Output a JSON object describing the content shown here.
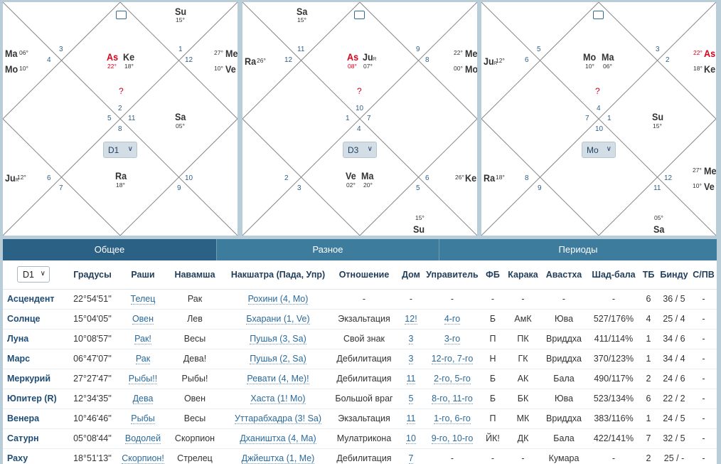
{
  "charts": [
    {
      "selector": "D1",
      "houses": [
        "1",
        "2",
        "3",
        "4",
        "5",
        "6",
        "7",
        "8",
        "9",
        "10",
        "11",
        "12"
      ],
      "planets": [
        {
          "name": "Su",
          "deg": "15°"
        },
        {
          "name": "As",
          "deg": "22°"
        },
        {
          "name": "Ke",
          "deg": "18°"
        },
        {
          "name": "Ma",
          "deg": "06°"
        },
        {
          "name": "Mo",
          "deg": "10°"
        },
        {
          "name": "Me",
          "deg": "27°"
        },
        {
          "name": "Ve",
          "deg": "10°"
        },
        {
          "name": "Sa",
          "deg": "05°"
        },
        {
          "name": "Ju",
          "deg": "12°",
          "sub": "R"
        },
        {
          "name": "Ra",
          "deg": "18°"
        }
      ]
    },
    {
      "selector": "D3",
      "houses": [
        "11",
        "12",
        "9",
        "8",
        "10",
        "1",
        "7",
        "4",
        "2",
        "3",
        "5",
        "6"
      ],
      "planets": [
        {
          "name": "Sa",
          "deg": "15°"
        },
        {
          "name": "Ra",
          "deg": "26°"
        },
        {
          "name": "As",
          "deg": "08°"
        },
        {
          "name": "Ju",
          "deg": "07°",
          "sub": "R"
        },
        {
          "name": "Me",
          "deg": "22°"
        },
        {
          "name": "Mo",
          "deg": "00°"
        },
        {
          "name": "Ve",
          "deg": "02°"
        },
        {
          "name": "Ma",
          "deg": "20°"
        },
        {
          "name": "Ke",
          "deg": "26°"
        },
        {
          "name": "Su",
          "deg": "15°"
        }
      ]
    },
    {
      "selector": "Mo",
      "houses": [
        "5",
        "6",
        "3",
        "2",
        "4",
        "7",
        "1",
        "10",
        "8",
        "9",
        "11",
        "12"
      ],
      "planets": [
        {
          "name": "Ju",
          "deg": "12°",
          "sub": "R"
        },
        {
          "name": "Mo",
          "deg": "10°"
        },
        {
          "name": "Ma",
          "deg": "06°"
        },
        {
          "name": "As",
          "deg": "22°"
        },
        {
          "name": "Ke",
          "deg": "18°"
        },
        {
          "name": "Su",
          "deg": "15°"
        },
        {
          "name": "Ra",
          "deg": "18°"
        },
        {
          "name": "Me",
          "deg": "27°"
        },
        {
          "name": "Ve",
          "deg": "10°"
        },
        {
          "name": "Sa",
          "deg": "05°"
        }
      ]
    }
  ],
  "question_mark": "?",
  "tabs": [
    "Общее",
    "Разное",
    "Периоды"
  ],
  "table": {
    "selector": "D1",
    "headers": [
      "Градусы",
      "Раши",
      "Навамша",
      "Накшатра (Пада, Упр)",
      "Отношение",
      "Дом",
      "Управитель",
      "ФБ",
      "Карака",
      "Авастха",
      "Шад-бала",
      "ТБ",
      "Бинду",
      "С/ПВ"
    ],
    "rows": [
      [
        "Асцендент",
        "22°54'51''",
        "Телец",
        "Рак",
        "Рохини (4, Mo)",
        "-",
        "-",
        "-",
        "-",
        "-",
        "-",
        "-",
        "6",
        "36 / 5",
        "-"
      ],
      [
        "Солнце",
        "15°04'05''",
        "Овен",
        "Лев",
        "Бхарани (1, Ve)",
        "Экзальтация",
        "12!",
        "4-го",
        "Б",
        "АмК",
        "Юва",
        "527/176%",
        "4",
        "25 / 4",
        "-"
      ],
      [
        "Луна",
        "10°08'57''",
        "Рак!",
        "Весы",
        "Пушья (3, Sa)",
        "Свой знак",
        "3",
        "3-го",
        "П",
        "ПК",
        "Вриддха",
        "411/114%",
        "1",
        "34 / 6",
        "-"
      ],
      [
        "Марс",
        "06°47'07''",
        "Рак",
        "Дева!",
        "Пушья (2, Sa)",
        "Дебилитация",
        "3",
        "12-го, 7-го",
        "Н",
        "ГК",
        "Вриддха",
        "370/123%",
        "1",
        "34 / 4",
        "-"
      ],
      [
        "Меркурий",
        "27°27'47''",
        "Рыбы!!",
        "Рыбы!",
        "Ревати (4, Me)!",
        "Дебилитация",
        "11",
        "2-го, 5-го",
        "Б",
        "АК",
        "Бала",
        "490/117%",
        "2",
        "24 / 6",
        "-"
      ],
      [
        "Юпитер (R)",
        "12°34'35''",
        "Дева",
        "Овен",
        "Хаста (1! Mo)",
        "Большой враг",
        "5",
        "8-го, 11-го",
        "Б",
        "БК",
        "Юва",
        "523/134%",
        "6",
        "22 / 2",
        "-"
      ],
      [
        "Венера",
        "10°46'46''",
        "Рыбы",
        "Весы",
        "Уттарабхадра (3! Sa)",
        "Экзальтация",
        "11",
        "1-го, 6-го",
        "П",
        "МК",
        "Вриддха",
        "383/116%",
        "1",
        "24 / 5",
        "-"
      ],
      [
        "Сатурн",
        "05°08'44''",
        "Водолей",
        "Скорпион",
        "Дхаништха (4, Ma)",
        "Мулатрикона",
        "10",
        "9-го, 10-го",
        "ЙК!",
        "ДК",
        "Бала",
        "422/141%",
        "7",
        "32 / 5",
        "-"
      ],
      [
        "Раху",
        "18°51'13''",
        "Скорпион!",
        "Стрелец",
        "Джйештха (1, Me)",
        "Дебилитация",
        "7",
        "-",
        "-",
        "-",
        "Кумара",
        "-",
        "2",
        "25 / -",
        "-"
      ]
    ]
  }
}
